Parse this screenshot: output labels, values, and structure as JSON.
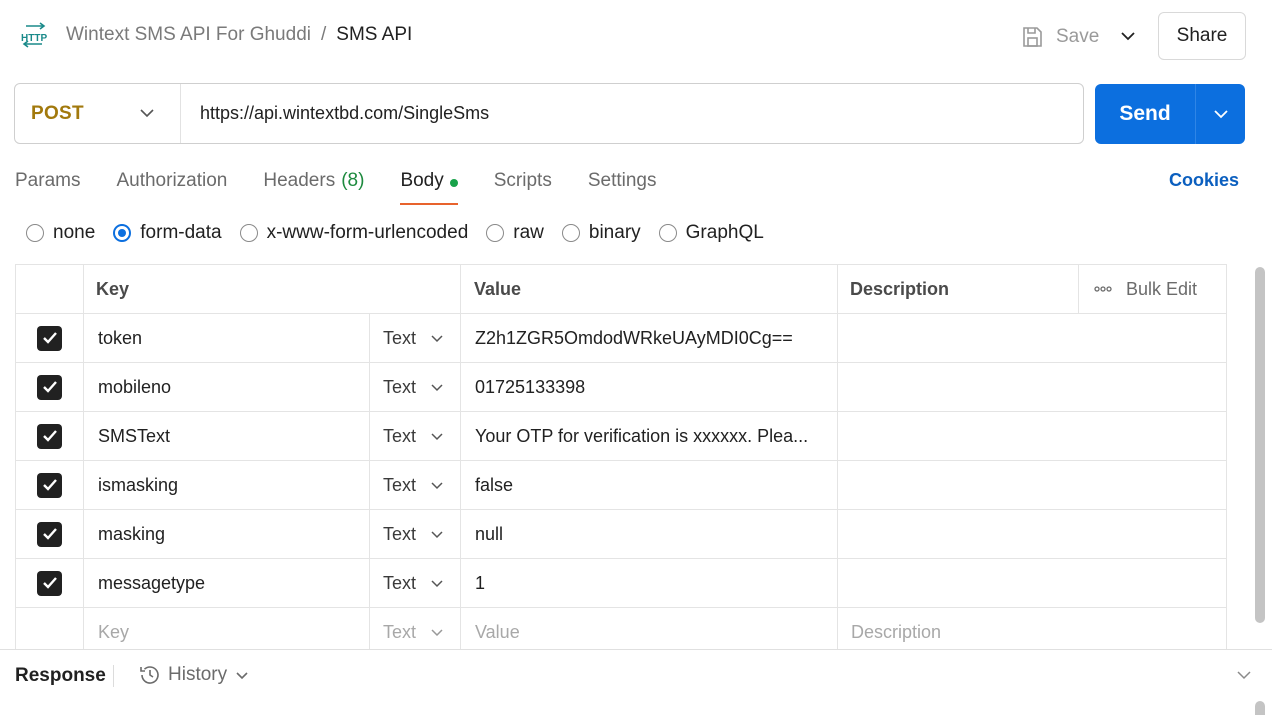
{
  "header": {
    "collection": "Wintext SMS API For Ghuddi",
    "separator": "/",
    "request_name": "SMS API",
    "save_label": "Save",
    "share_label": "Share",
    "http_icon": "http-icon"
  },
  "request": {
    "method": "POST",
    "url": "https://api.wintextbd.com/SingleSms",
    "send_label": "Send"
  },
  "tabs": [
    {
      "label": "Params"
    },
    {
      "label": "Authorization"
    },
    {
      "label": "Headers",
      "count": "(8)"
    },
    {
      "label": "Body",
      "active": true
    },
    {
      "label": "Scripts"
    },
    {
      "label": "Settings"
    }
  ],
  "cookies_label": "Cookies",
  "body_types": [
    "none",
    "form-data",
    "x-www-form-urlencoded",
    "raw",
    "binary",
    "GraphQL"
  ],
  "body_type_selected": "form-data",
  "table": {
    "headers": {
      "key": "Key",
      "value": "Value",
      "description": "Description",
      "bulk_edit": "Bulk Edit"
    },
    "rows": [
      {
        "key": "token",
        "type": "Text",
        "value": "Z2h1ZGR5OmdodWRkeUAyMDI0Cg==",
        "description": ""
      },
      {
        "key": "mobileno",
        "type": "Text",
        "value": "01725133398",
        "description": ""
      },
      {
        "key": "SMSText",
        "type": "Text",
        "value": "Your OTP for verification is xxxxxx. Plea...",
        "description": ""
      },
      {
        "key": "ismasking",
        "type": "Text",
        "value": "false",
        "description": ""
      },
      {
        "key": "masking",
        "type": "Text",
        "value": "null",
        "description": ""
      },
      {
        "key": "messagetype",
        "type": "Text",
        "value": "1",
        "description": ""
      }
    ],
    "placeholder": {
      "key": "Key",
      "type": "Text",
      "value": "Value",
      "description": "Description"
    }
  },
  "response": {
    "label": "Response",
    "history_label": "History"
  },
  "colors": {
    "method": "#a2790d",
    "send": "#0c6fdf",
    "active_tab_underline": "#e8632d",
    "headers_count": "#1d8a3e",
    "body_dot": "#18a24a",
    "cookies": "#0b5fbf"
  }
}
